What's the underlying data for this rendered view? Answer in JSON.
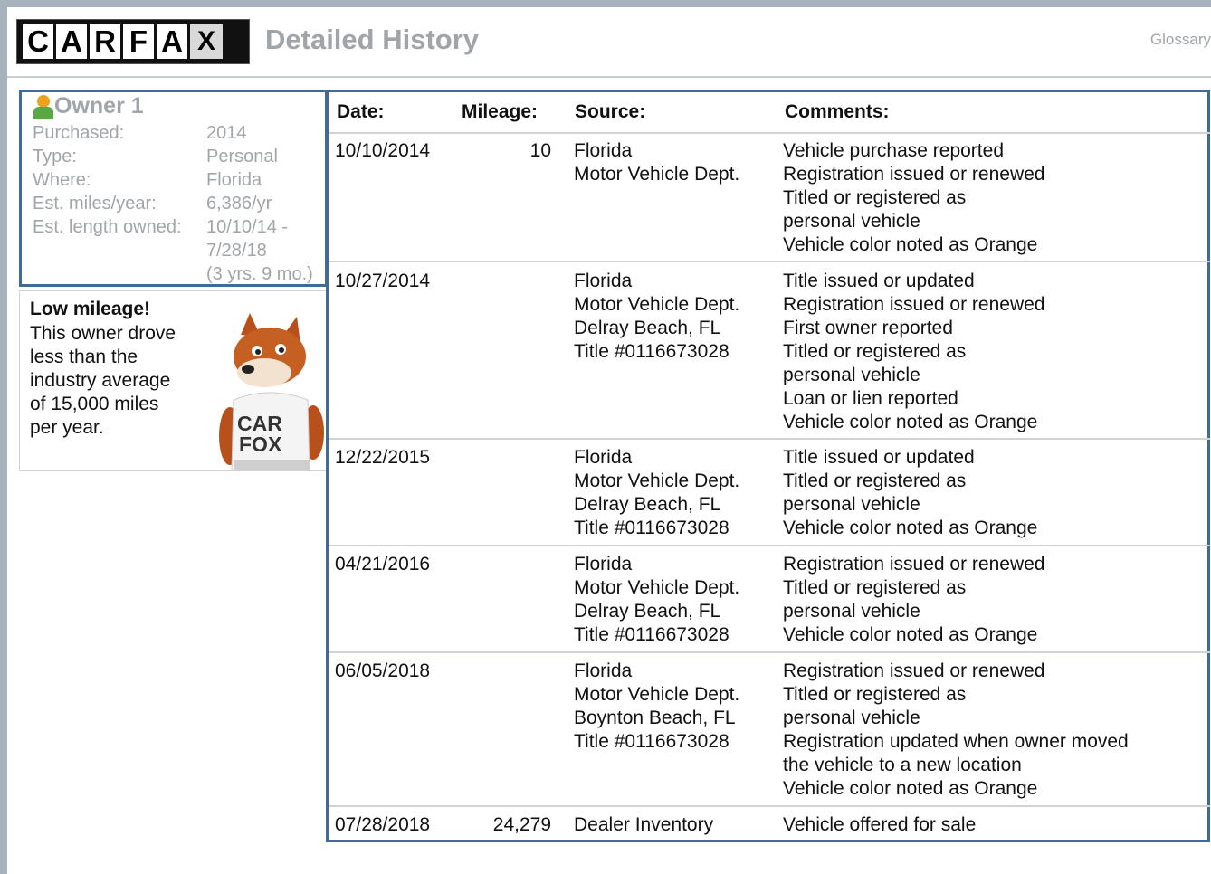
{
  "logo": {
    "letters": [
      "C",
      "A",
      "R",
      "F",
      "A",
      "X"
    ]
  },
  "header": {
    "title": "Detailed History",
    "glossary_link": "Glossary"
  },
  "owner": {
    "title": "Owner 1",
    "fields": [
      {
        "label": "Purchased:",
        "value": "2014"
      },
      {
        "label": "Type:",
        "value": "Personal"
      },
      {
        "label": "Where:",
        "value": "Florida"
      },
      {
        "label": "Est. miles/year:",
        "value": "6,386/yr"
      },
      {
        "label": "Est. length owned:",
        "value": "10/10/14 -"
      }
    ],
    "length_line2": "7/28/18",
    "length_line3": "(3 yrs. 9 mo.)"
  },
  "tip": {
    "heading": "Low mileage!",
    "lines": [
      "This owner drove",
      "less than the",
      "industry average",
      "of 15,000 miles",
      "per year."
    ],
    "mascot_shirt": [
      "CAR",
      "FOX"
    ]
  },
  "table": {
    "headers": {
      "date": "Date:",
      "mileage": "Mileage:",
      "source": "Source:",
      "comments": "Comments:"
    },
    "rows": [
      {
        "date": "10/10/2014",
        "mileage": "10",
        "source": [
          "Florida",
          "Motor Vehicle Dept."
        ],
        "comments": [
          "Vehicle purchase reported",
          "Registration issued or renewed",
          "Titled or registered as",
          "personal vehicle",
          "Vehicle color noted as Orange"
        ]
      },
      {
        "date": "10/27/2014",
        "mileage": "",
        "source": [
          "Florida",
          "Motor Vehicle Dept.",
          "Delray Beach, FL",
          "Title #0116673028"
        ],
        "comments": [
          "Title issued or updated",
          "Registration issued or renewed",
          "First owner reported",
          "Titled or registered as",
          "personal vehicle",
          "Loan or lien reported",
          "Vehicle color noted as Orange"
        ]
      },
      {
        "date": "12/22/2015",
        "mileage": "",
        "source": [
          "Florida",
          "Motor Vehicle Dept.",
          "Delray Beach, FL",
          "Title #0116673028"
        ],
        "comments": [
          "Title issued or updated",
          "Titled or registered as",
          "personal vehicle",
          "Vehicle color noted as Orange"
        ]
      },
      {
        "date": "04/21/2016",
        "mileage": "",
        "source": [
          "Florida",
          "Motor Vehicle Dept.",
          "Delray Beach, FL",
          "Title #0116673028"
        ],
        "comments": [
          "Registration issued or renewed",
          "Titled or registered as",
          "personal vehicle",
          "Vehicle color noted as Orange"
        ]
      },
      {
        "date": "06/05/2018",
        "mileage": "",
        "source": [
          "Florida",
          "Motor Vehicle Dept.",
          "Boynton Beach, FL",
          "Title #0116673028"
        ],
        "comments": [
          "Registration issued or renewed",
          "Titled or registered as",
          "personal vehicle",
          "Registration updated when owner moved",
          "the vehicle to a new location",
          "Vehicle color noted as Orange"
        ]
      },
      {
        "date": "07/28/2018",
        "mileage": "24,279",
        "source": [
          "Dealer Inventory"
        ],
        "comments": [
          "Vehicle offered for sale"
        ]
      }
    ]
  },
  "colors": {
    "frame_blue": "#3f6b96",
    "muted_gray": "#a0a5aa",
    "logo_black": "#111111"
  }
}
